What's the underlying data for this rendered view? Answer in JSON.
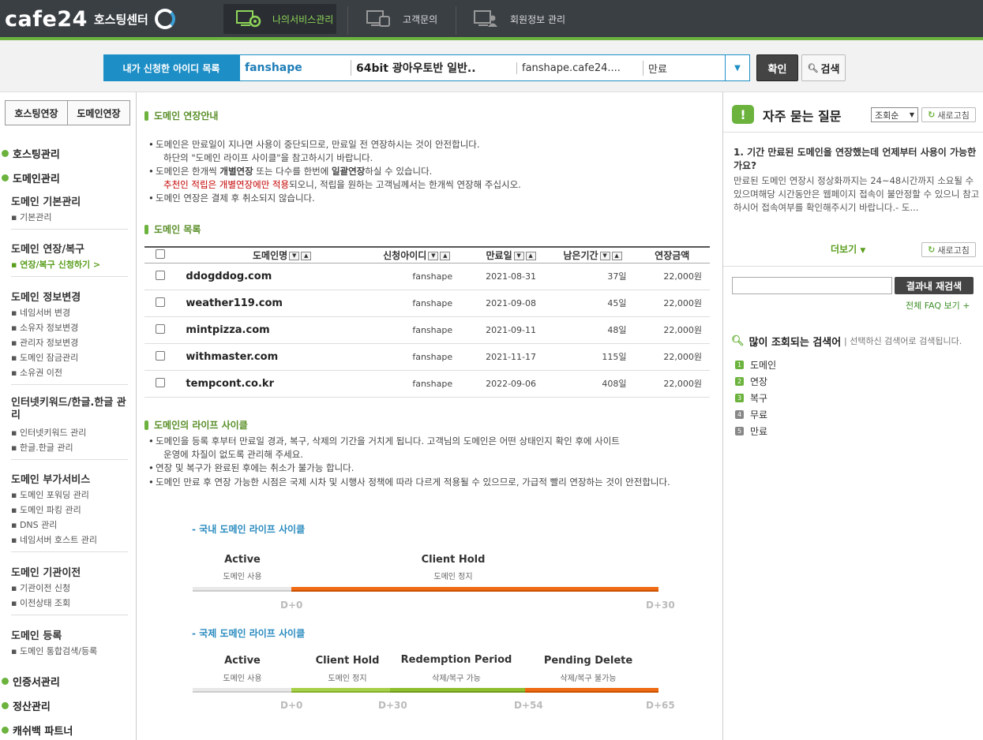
{
  "header": {
    "logo": "cafe24",
    "logo_sub": "호스팅센터",
    "nav": [
      {
        "label": "나의서비스관리",
        "active": true
      },
      {
        "label": "고객문의",
        "active": false
      },
      {
        "label": "회원정보 관리",
        "active": false
      }
    ]
  },
  "id_bar": {
    "label": "내가 신청한 아이디 목록",
    "selected": {
      "id": "fanshape",
      "product": "64bit 광아우토반 일반..",
      "domain": "fanshape.cafe24....",
      "status": "만료"
    },
    "confirm_label": "확인",
    "search_label": "검색"
  },
  "sidebar": {
    "tabs": [
      "호스팅연장",
      "도메인연장"
    ],
    "groups": {
      "hosting": "호스팅관리",
      "domain": "도메인관리",
      "cert": "인증서관리",
      "billing": "정산관리",
      "cashback": "캐쉬백 파트너"
    },
    "sections": [
      {
        "title": "도메인 기본관리",
        "items": [
          "기본관리"
        ]
      },
      {
        "title": "도메인 연장/복구",
        "items": [
          "연장/복구 신청하기 >"
        ]
      },
      {
        "title": "도메인 정보변경",
        "items": [
          "네임서버 변경",
          "소유자 정보변경",
          "관리자 정보변경",
          "도메인 잠금관리",
          "소유권 이전"
        ]
      },
      {
        "title": "인터넷키워드/한글.한글 관리",
        "items": [
          "인터넷키워드 관리",
          "한글.한글 관리"
        ]
      },
      {
        "title": "도메인 부가서비스",
        "items": [
          "도메인 포워딩 관리",
          "도메인 파킹 관리",
          "DNS 관리",
          "네임서버 호스트 관리"
        ]
      },
      {
        "title": "도메인 기관이전",
        "items": [
          "기관이전 신청",
          "이전상태 조회"
        ]
      },
      {
        "title": "도메인 등록",
        "items": [
          "도메인 통합검색/등록"
        ]
      }
    ]
  },
  "main": {
    "guide_title": "도메인 연장안내",
    "guide": {
      "l1": "도메인은 만료일이 지나면 사용이 중단되므로, 만료일 전 연장하시는 것이 안전합니다.",
      "l1b": "하단의 \"도메인 라이프 사이클\"을 참고하시기 바랍니다.",
      "l2a": "도메인은 한개씩 ",
      "l2b": "개별연장",
      "l2c": " 또는 다수를 한번에 ",
      "l2d": "일괄연장",
      "l2e": "하실 수 있습니다.",
      "l3a": "추천인 적립은 개별연장에만 적용",
      "l3b": "되오니, 적립을 원하는 고객님께서는 한개씩 연장해 주십시오.",
      "l4": "도메인 연장은 결제 후 취소되지 않습니다."
    },
    "list_title": "도메인 목록",
    "columns": [
      "도메인명",
      "신청아이디",
      "만료일",
      "남은기간",
      "연장금액"
    ],
    "rows": [
      {
        "domain": "ddogddog.com",
        "id": "fanshape",
        "expire": "2021-08-31",
        "remain": "37일",
        "price": "22,000원"
      },
      {
        "domain": "weather119.com",
        "id": "fanshape",
        "expire": "2021-09-08",
        "remain": "45일",
        "price": "22,000원"
      },
      {
        "domain": "mintpizza.com",
        "id": "fanshape",
        "expire": "2021-09-11",
        "remain": "48일",
        "price": "22,000원"
      },
      {
        "domain": "withmaster.com",
        "id": "fanshape",
        "expire": "2021-11-17",
        "remain": "115일",
        "price": "22,000원"
      },
      {
        "domain": "tempcont.co.kr",
        "id": "fanshape",
        "expire": "2022-09-06",
        "remain": "408일",
        "price": "22,000원"
      }
    ],
    "lifecycle_title": "도메인의 라이프 사이클",
    "lifecycle": {
      "l1": "도메인을 등록 후부터 만료일 경과, 복구, 삭제의 기간을 거치게 됩니다. 고객님의 도메인은 어떤 상태인지 확인 후에 사이트",
      "l1b": "운영에 차질이 없도록 관리해 주세요.",
      "l2": "연장 및 복구가 완료된 후에는 취소가 불가능 합니다.",
      "l3": "도메인 만료 후 연장 가능한 시점은 국제 시차 및 시행사 정책에 따라 다르게 적용될 수 있으므로, 가급적 빨리 연장하는 것이 안전합니다."
    },
    "domestic": {
      "title": "- 국내 도메인 라이프 사이클",
      "phases": [
        {
          "name": "Active",
          "desc": "도메인 사용"
        },
        {
          "name": "Client Hold",
          "desc": "도메인 정지"
        }
      ],
      "ticks": [
        "D+0",
        "D+30"
      ]
    },
    "international": {
      "title": "- 국제 도메인 라이프 사이클",
      "phases": [
        {
          "name": "Active",
          "desc": "도메인 사용"
        },
        {
          "name": "Client Hold",
          "desc": "도메인 정지"
        },
        {
          "name": "Redemption Period",
          "desc": "삭제/복구 가능"
        },
        {
          "name": "Pending Delete",
          "desc": "삭제/복구 불가능"
        }
      ],
      "ticks": [
        "D+0",
        "D+30",
        "D+54",
        "D+65"
      ]
    }
  },
  "faq": {
    "title": "자주 묻는 질문",
    "sort": "조회순",
    "refresh": "새로고침",
    "q_title": "1. 기간 만료된 도메인을 연장했는데 언제부터 사용이 가능한가요?",
    "q_body": "만료된 도메인 연장시 정상화까지는 24~48시간까지 소요될 수 있으며해당 시간동안은 웹페이지 접속이 불안정할 수 있으니 참고하시어 접속여부를 확인해주시기 바랍니다.- 도...",
    "more": "더보기",
    "research_label": "결과내 재검색",
    "all_faq": "전체 FAQ 보기",
    "popular_title": "많이 조회되는 검색어",
    "popular_note": "선택하신 검색어로 검색됩니다.",
    "popular": [
      "도메인",
      "연장",
      "복구",
      "무료",
      "만료"
    ]
  },
  "colors": {
    "brand_green": "#6cb33e",
    "blue": "#1e8fc6",
    "orange": "#ef6a12",
    "lime": "#9acb3c",
    "dark": "#3a3f44"
  }
}
